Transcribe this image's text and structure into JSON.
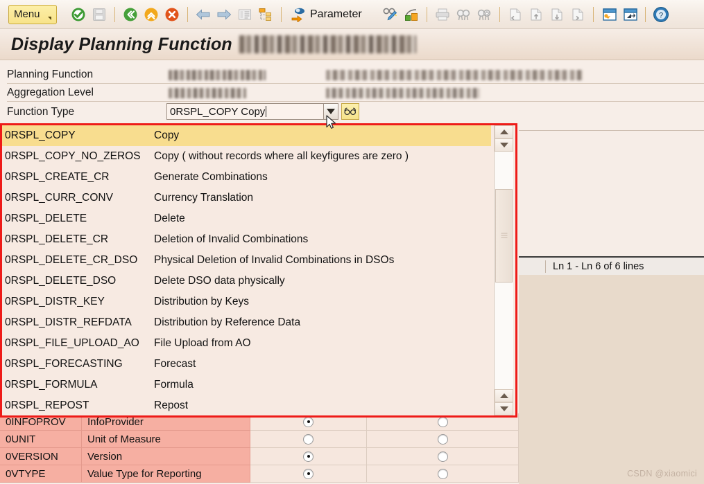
{
  "toolbar": {
    "menu_label": "Menu",
    "parameter_label": "Parameter",
    "icons": [
      {
        "name": "check-enter-icon",
        "title": "Enter"
      },
      {
        "name": "save-icon",
        "title": "Save"
      },
      {
        "name": "back-icon",
        "title": "Back"
      },
      {
        "name": "exit-icon",
        "title": "Exit"
      },
      {
        "name": "cancel-icon",
        "title": "Cancel"
      },
      {
        "name": "arrow-left-icon",
        "title": "Previous"
      },
      {
        "name": "arrow-right-icon",
        "title": "Next"
      },
      {
        "name": "list-icon",
        "title": "List"
      },
      {
        "name": "hierarchy-icon",
        "title": "Hierarchy"
      },
      {
        "name": "parameter-icon",
        "title": "Parameter"
      },
      {
        "name": "glasses-pencil-icon",
        "title": "Display/Change"
      },
      {
        "name": "chart-green-orange-icon",
        "title": "Graphic"
      },
      {
        "name": "print-icon",
        "title": "Print"
      },
      {
        "name": "find-icon",
        "title": "Find"
      },
      {
        "name": "find-next-icon",
        "title": "Find Next"
      },
      {
        "name": "first-page-icon",
        "title": "First Page"
      },
      {
        "name": "prev-page-icon",
        "title": "Previous Page"
      },
      {
        "name": "next-page-icon",
        "title": "Next Page"
      },
      {
        "name": "last-page-icon",
        "title": "Last Page"
      },
      {
        "name": "new-window-icon",
        "title": "Create Session"
      },
      {
        "name": "shortcut-icon",
        "title": "Create Shortcut"
      },
      {
        "name": "help-icon",
        "title": "Help"
      }
    ]
  },
  "title": {
    "prefix": "Display Planning Function",
    "object_redacted": true
  },
  "form": {
    "rows": [
      {
        "label": "Planning Function",
        "value_redacted": true,
        "desc_redacted": true
      },
      {
        "label": "Aggregation Level",
        "value_redacted": true,
        "desc_redacted": true
      },
      {
        "label": "Function Type",
        "value": "0RSPL_COPY Copy"
      }
    ],
    "dropdown_open": true
  },
  "status": {
    "lines_text": "Ln 1 - Ln 6 of 6 lines"
  },
  "dropdown": {
    "selected_key": "0RSPL_COPY",
    "items": [
      {
        "key": "0RSPL_COPY",
        "description": "Copy"
      },
      {
        "key": "0RSPL_COPY_NO_ZEROS",
        "description": "Copy ( without records where all keyfigures are zero )"
      },
      {
        "key": "0RSPL_CREATE_CR",
        "description": "Generate Combinations"
      },
      {
        "key": "0RSPL_CURR_CONV",
        "description": "Currency Translation"
      },
      {
        "key": "0RSPL_DELETE",
        "description": "Delete"
      },
      {
        "key": "0RSPL_DELETE_CR",
        "description": "Deletion of Invalid Combinations"
      },
      {
        "key": "0RSPL_DELETE_CR_DSO",
        "description": "Physical Deletion of Invalid Combinations in DSOs"
      },
      {
        "key": "0RSPL_DELETE_DSO",
        "description": "Delete DSO data physically"
      },
      {
        "key": "0RSPL_DISTR_KEY",
        "description": "Distribution by Keys"
      },
      {
        "key": "0RSPL_DISTR_REFDATA",
        "description": "Distribution by Reference Data"
      },
      {
        "key": "0RSPL_FILE_UPLOAD_AO",
        "description": "File Upload from AO"
      },
      {
        "key": "0RSPL_FORECASTING",
        "description": "Forecast"
      },
      {
        "key": "0RSPL_FORMULA",
        "description": "Formula"
      },
      {
        "key": "0RSPL_REPOST",
        "description": "Repost"
      }
    ]
  },
  "characteristics_table": {
    "rows": [
      {
        "key": "0INFOPROV",
        "text": "InfoProvider",
        "col1_selected": true,
        "col2_selected": false,
        "clipped": true
      },
      {
        "key": "0UNIT",
        "text": "Unit of Measure",
        "col1_selected": false,
        "col2_selected": false,
        "clipped": false
      },
      {
        "key": "0VERSION",
        "text": "Version",
        "col1_selected": true,
        "col2_selected": false,
        "clipped": false
      },
      {
        "key": "0VTYPE",
        "text": "Value Type for Reporting",
        "col1_selected": true,
        "col2_selected": false,
        "clipped": false
      }
    ]
  },
  "watermark": {
    "text": "CSDN @xiaomici"
  },
  "colors": {
    "highlight_row": "#F8DD8F",
    "list_background": "#F7EAE2",
    "callout_border": "#EE1B18",
    "table_key_cell": "#F6AFA2",
    "page_background": "#F7EEE8"
  }
}
